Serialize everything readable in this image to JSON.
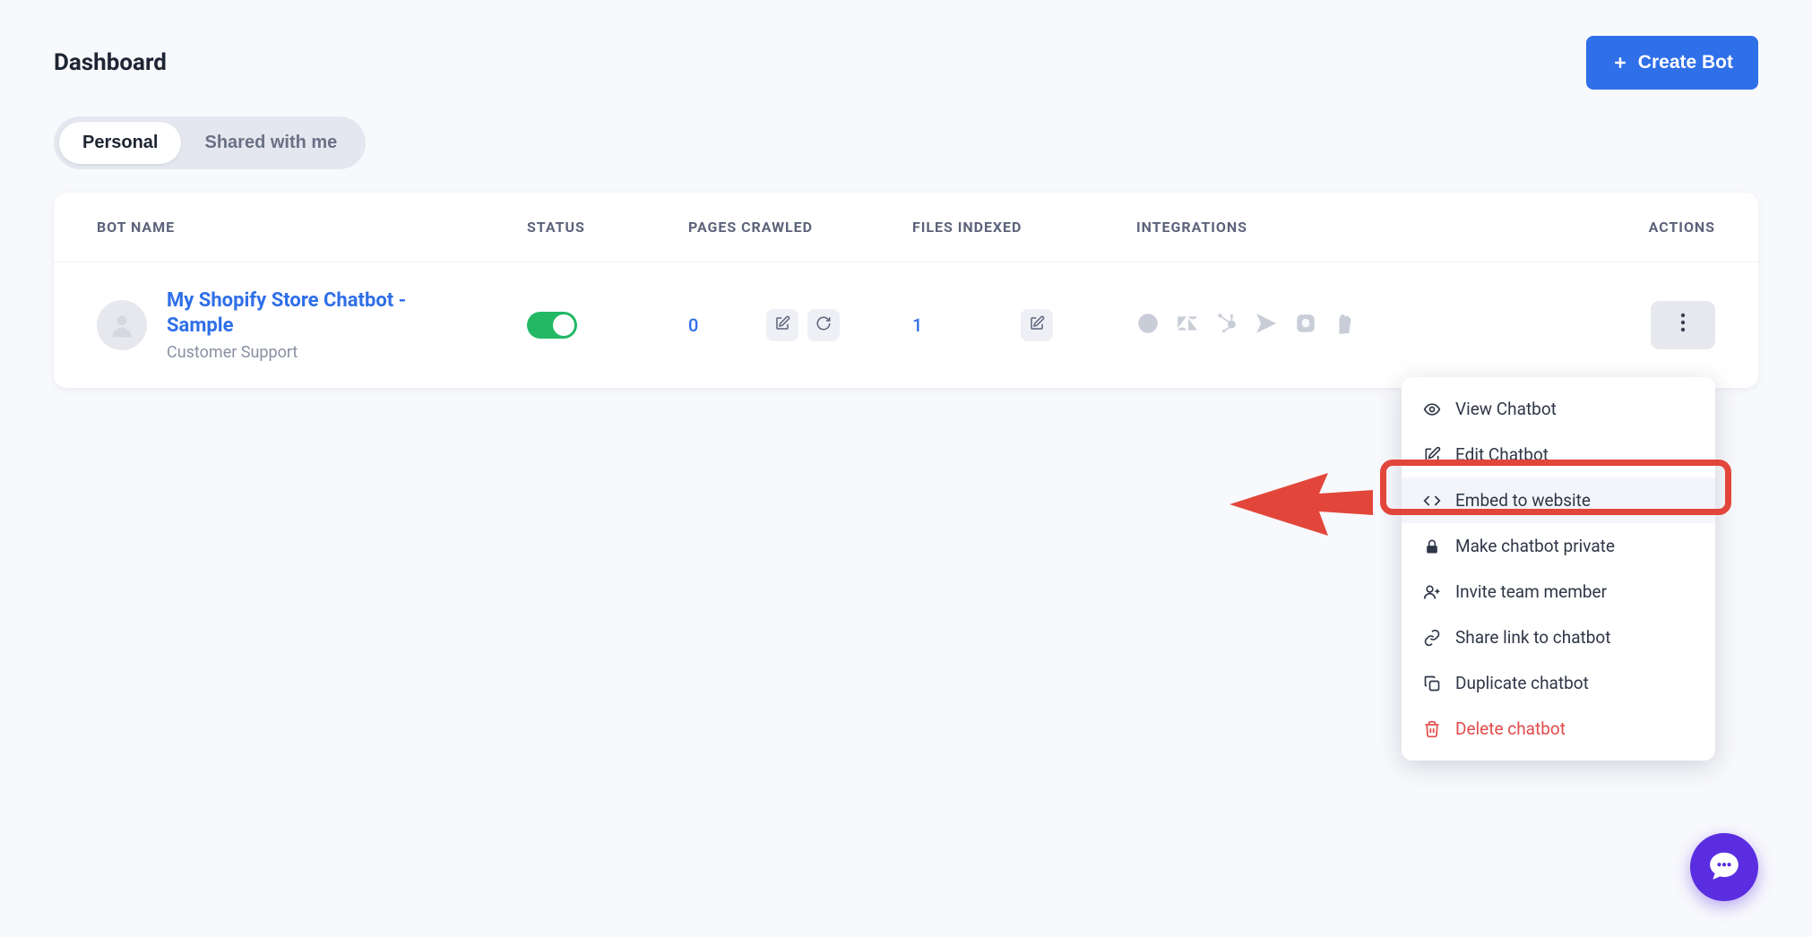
{
  "header": {
    "title": "Dashboard",
    "create_label": "Create Bot"
  },
  "tabs": {
    "personal": "Personal",
    "shared": "Shared with me"
  },
  "table": {
    "headers": {
      "name": "BOT NAME",
      "status": "STATUS",
      "pages": "PAGES CRAWLED",
      "files": "FILES INDEXED",
      "integrations": "INTEGRATIONS",
      "actions": "ACTIONS"
    },
    "row": {
      "name": "My Shopify Store Chatbot - Sample",
      "subtitle": "Customer Support",
      "pages_crawled": "0",
      "files_indexed": "1"
    }
  },
  "menu": {
    "view": "View Chatbot",
    "edit": "Edit Chatbot",
    "embed": "Embed to website",
    "private": "Make chatbot private",
    "invite": "Invite team member",
    "share": "Share link to chatbot",
    "duplicate": "Duplicate chatbot",
    "delete": "Delete chatbot"
  }
}
